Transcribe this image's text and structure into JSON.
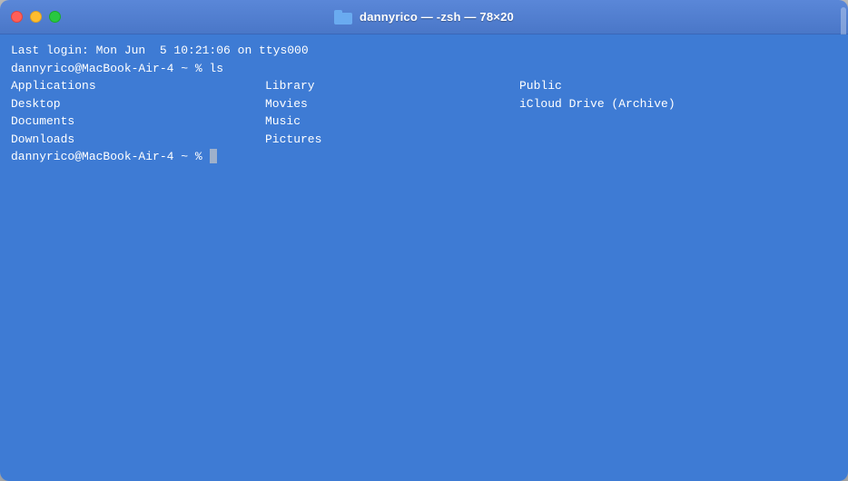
{
  "window": {
    "title": "dannyrico — -zsh — 78×20",
    "traffic_lights": {
      "close_label": "close",
      "minimize_label": "minimize",
      "maximize_label": "maximize"
    }
  },
  "terminal": {
    "login_line": "Last login: Mon Jun  5 10:21:06 on ttys000",
    "prompt1": "dannyrico@MacBook-Air-4 ~ % ls",
    "prompt2": "dannyrico@MacBook-Air-4 ~ % ",
    "ls_items": {
      "col1": [
        "Applications",
        "Desktop",
        "Documents",
        "Downloads"
      ],
      "col2": [
        "Library",
        "Movies",
        "Music",
        "Pictures"
      ],
      "col3": [
        "Public",
        "iCloud Drive (Archive)",
        "",
        ""
      ]
    }
  },
  "colors": {
    "terminal_bg": "#3e7bd4",
    "titlebar_bg": "#4a77c8",
    "text": "#ffffff",
    "close": "#ff5f57",
    "minimize": "#ffbd2e",
    "maximize": "#28c840"
  }
}
